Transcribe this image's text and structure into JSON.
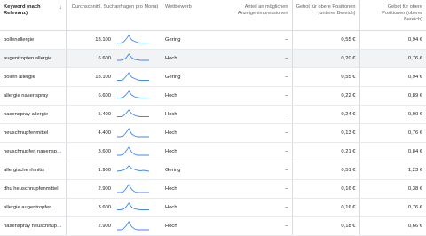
{
  "table": {
    "headers": {
      "keyword": "Keyword (nach Relevanz)",
      "volume": "Durchschnittl. Suchanfragen pro Monat",
      "competition": "Wettbewerb",
      "impression_share": "Anteil an möglichen Anzeigenimpressionen",
      "bid_low": "Gebot für obere Positionen (unterer Bereich)",
      "bid_high": "Gebot für obere Positionen (oberer Bereich)"
    },
    "sort_icon": "arrow-down-icon",
    "trend_color": "#4285f4",
    "selected_row_color": "#f1f3f4",
    "rows": [
      {
        "keyword": "pollenallergie",
        "volume": "18.100",
        "competition": "Gering",
        "share": "–",
        "bid_low": "0,55 €",
        "bid_high": "0,94 €",
        "trend": [
          0.15,
          0.15,
          0.2,
          0.55,
          1.0,
          0.5,
          0.35,
          0.2,
          0.15,
          0.15,
          0.15,
          0.15
        ]
      },
      {
        "keyword": "augentropfen allergie",
        "volume": "6.600",
        "competition": "Hoch",
        "share": "–",
        "bid_low": "0,20 €",
        "bid_high": "0,76 €",
        "trend": [
          0.3,
          0.3,
          0.35,
          0.55,
          1.0,
          0.6,
          0.4,
          0.35,
          0.3,
          0.3,
          0.3,
          0.3
        ]
      },
      {
        "keyword": "pollen allergie",
        "volume": "18.100",
        "competition": "Gering",
        "share": "–",
        "bid_low": "0,55 €",
        "bid_high": "0,94 €",
        "trend": [
          0.15,
          0.15,
          0.2,
          0.55,
          1.0,
          0.5,
          0.35,
          0.2,
          0.15,
          0.15,
          0.15,
          0.15
        ]
      },
      {
        "keyword": "allergie nasenspray",
        "volume": "6.600",
        "competition": "Hoch",
        "share": "–",
        "bid_low": "0,22 €",
        "bid_high": "0,89 €",
        "trend": [
          0.25,
          0.25,
          0.3,
          0.6,
          1.0,
          0.6,
          0.4,
          0.3,
          0.25,
          0.25,
          0.25,
          0.25
        ]
      },
      {
        "keyword": "nasenspray allergie",
        "volume": "5.400",
        "competition": "Hoch",
        "share": "–",
        "bid_low": "0,24 €",
        "bid_high": "0,90 €",
        "trend": [
          0.25,
          0.25,
          0.3,
          0.6,
          1.0,
          0.6,
          0.4,
          0.3,
          0.25,
          0.25,
          0.25,
          0.25
        ]
      },
      {
        "keyword": "heuschnupfenmittel",
        "volume": "4.400",
        "competition": "Hoch",
        "share": "–",
        "bid_low": "0,13 €",
        "bid_high": "0,76 €",
        "trend": [
          0.1,
          0.1,
          0.15,
          0.5,
          1.0,
          0.4,
          0.2,
          0.1,
          0.1,
          0.1,
          0.1,
          0.1
        ]
      },
      {
        "keyword": "heuschnupfen nasensp…",
        "volume": "3.600",
        "competition": "Hoch",
        "share": "–",
        "bid_low": "0,21 €",
        "bid_high": "0,84 €",
        "trend": [
          0.1,
          0.1,
          0.15,
          0.55,
          1.0,
          0.45,
          0.2,
          0.1,
          0.1,
          0.1,
          0.1,
          0.1
        ]
      },
      {
        "keyword": "allergische rhinitis",
        "volume": "1.900",
        "competition": "Gering",
        "share": "–",
        "bid_low": "0,51 €",
        "bid_high": "1,23 €",
        "trend": [
          0.4,
          0.45,
          0.5,
          0.65,
          1.0,
          0.7,
          0.6,
          0.5,
          0.45,
          0.5,
          0.45,
          0.4
        ]
      },
      {
        "keyword": "dhu heuschnupfenmittel",
        "volume": "2.900",
        "competition": "Hoch",
        "share": "–",
        "bid_low": "0,16 €",
        "bid_high": "0,38 €",
        "trend": [
          0.1,
          0.1,
          0.15,
          0.5,
          1.0,
          0.45,
          0.2,
          0.1,
          0.1,
          0.1,
          0.1,
          0.1
        ]
      },
      {
        "keyword": "allergie augentropfen",
        "volume": "3.600",
        "competition": "Hoch",
        "share": "–",
        "bid_low": "0,16 €",
        "bid_high": "0,76 €",
        "trend": [
          0.25,
          0.25,
          0.3,
          0.55,
          1.0,
          0.55,
          0.35,
          0.3,
          0.25,
          0.25,
          0.25,
          0.25
        ]
      },
      {
        "keyword": "nasenspray heuschnup…",
        "volume": "2.900",
        "competition": "Hoch",
        "share": "–",
        "bid_low": "0,18 €",
        "bid_high": "0,66 €",
        "trend": [
          0.1,
          0.1,
          0.15,
          0.5,
          1.0,
          0.45,
          0.2,
          0.1,
          0.1,
          0.1,
          0.1,
          0.1
        ]
      }
    ]
  }
}
